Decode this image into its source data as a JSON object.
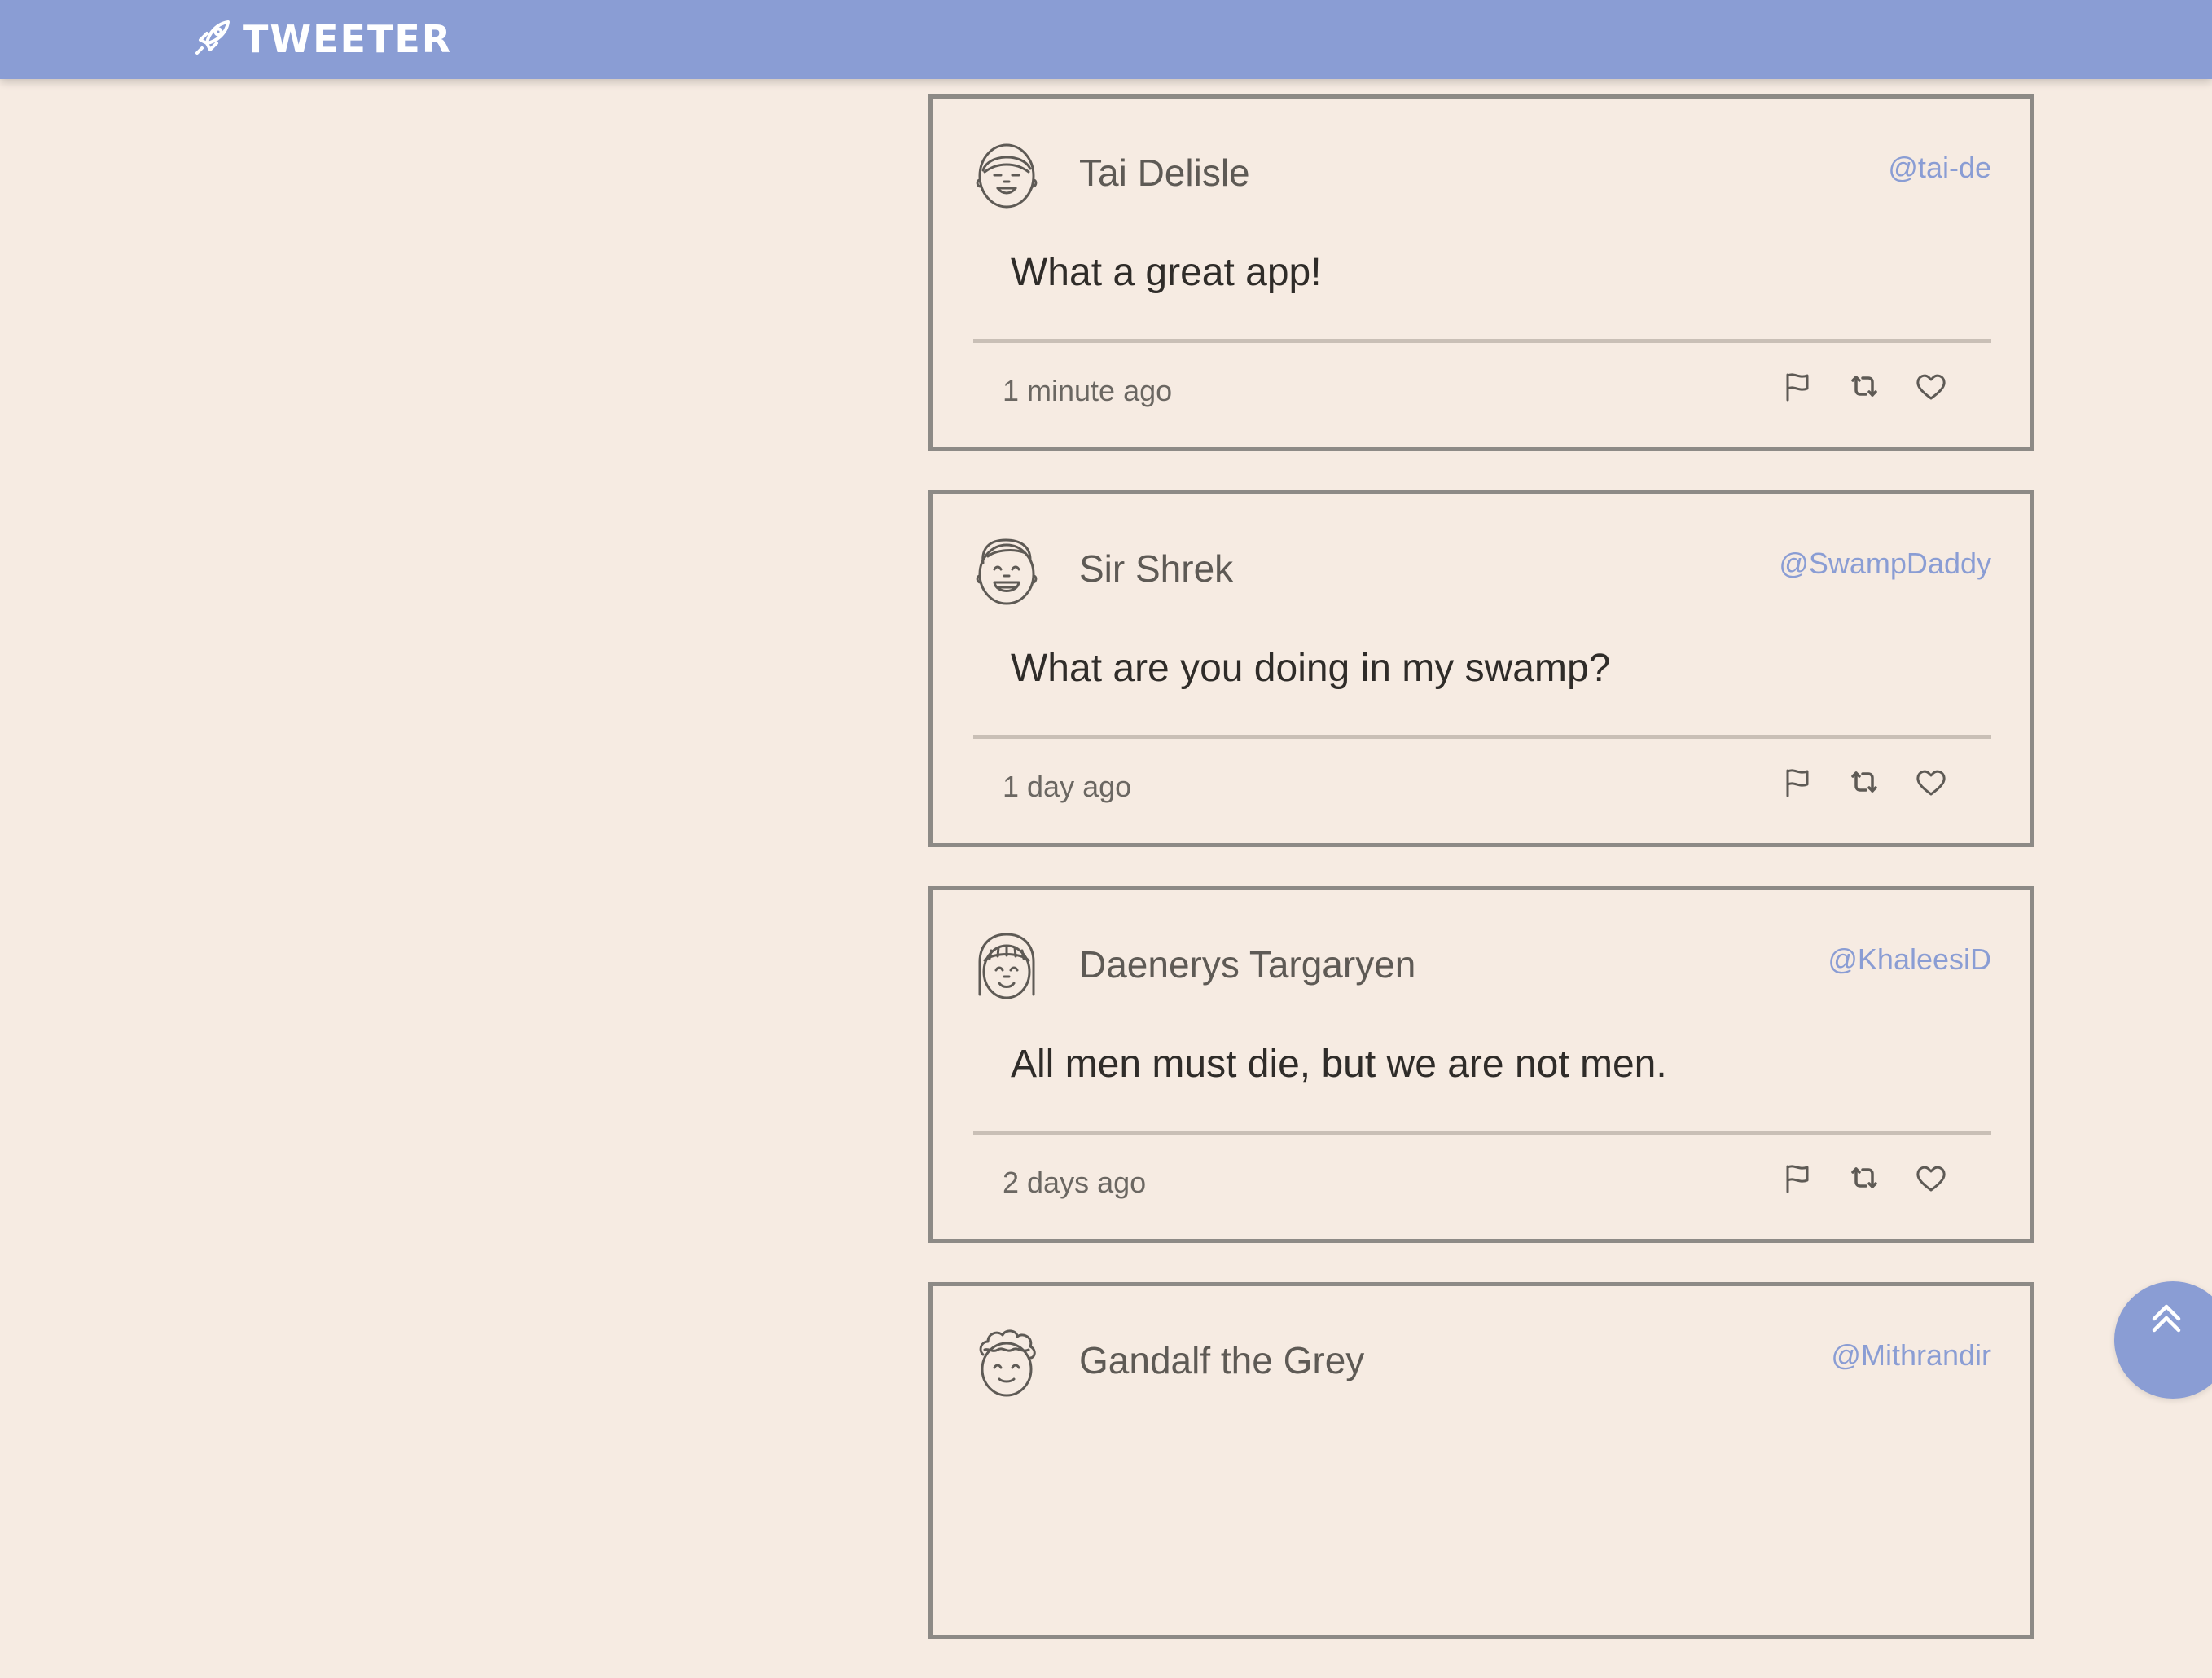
{
  "nav": {
    "brand": "TWEETER",
    "brand_icon": "rocket-icon"
  },
  "colors": {
    "background": "#f6ebe2",
    "nav": "#8a9dd4",
    "accent": "#8a9dd4",
    "border": "#8d8a86"
  },
  "tweets": [
    {
      "name": "Tai Delisle",
      "handle": "@tai-de",
      "text": "What a great app!",
      "time": "1 minute ago",
      "avatar": "smiling-face-avatar-icon"
    },
    {
      "name": "Sir Shrek",
      "handle": "@SwampDaddy",
      "text": "What are you doing in my swamp?",
      "time": "1 day ago",
      "avatar": "laughing-face-avatar-icon"
    },
    {
      "name": "Daenerys Targaryen",
      "handle": "@KhaleesiD",
      "text": "All men must die, but we are not men.",
      "time": "2 days ago",
      "avatar": "bangs-face-avatar-icon"
    },
    {
      "name": "Gandalf the Grey",
      "handle": "@Mithrandir",
      "text": "",
      "time": "",
      "avatar": "curly-hair-avatar-icon"
    }
  ],
  "actions": [
    "flag-icon",
    "retweet-icon",
    "heart-icon"
  ],
  "scroll_top_icon": "double-chevron-up-icon"
}
